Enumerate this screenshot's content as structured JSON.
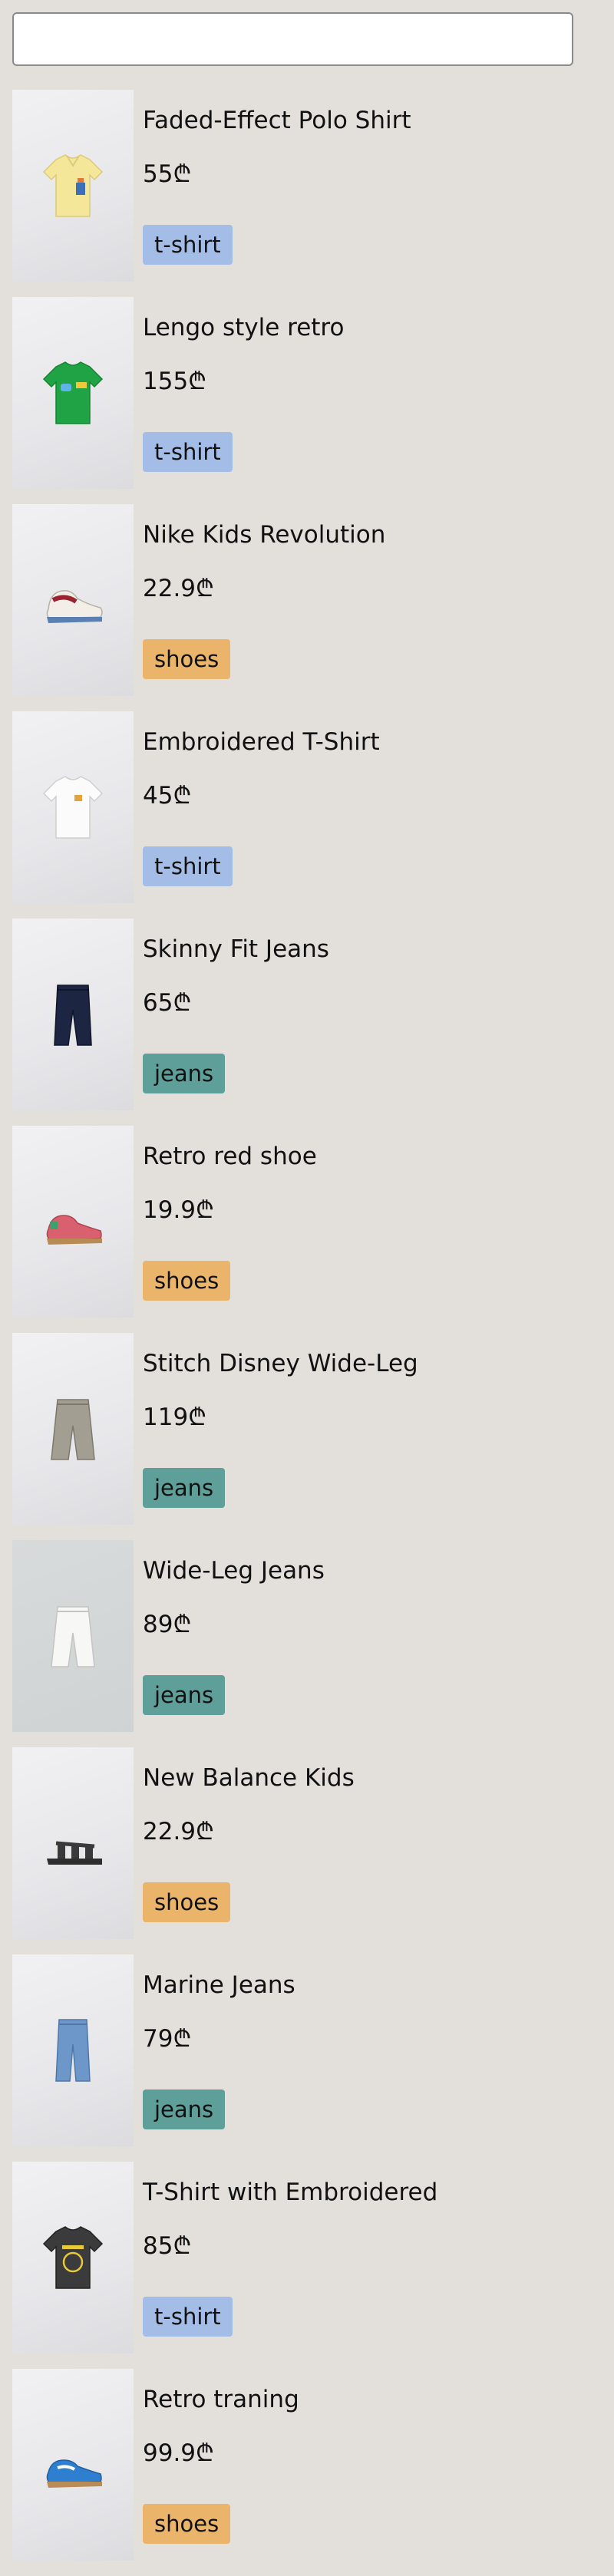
{
  "search": {
    "value": "",
    "placeholder": ""
  },
  "products": [
    {
      "name": "Faded-Effect Polo Shirt",
      "price": "55₾",
      "tag": "t-shirt",
      "icon": "yellow-polo-shirt-image"
    },
    {
      "name": "Lengo style retro",
      "price": "155₾",
      "tag": "t-shirt",
      "icon": "green-tshirt-image"
    },
    {
      "name": "Nike Kids Revolution",
      "price": "22.9₾",
      "tag": "shoes",
      "icon": "sneaker-image"
    },
    {
      "name": "Embroidered T-Shirt",
      "price": "45₾",
      "tag": "t-shirt",
      "icon": "white-tshirt-image"
    },
    {
      "name": "Skinny Fit Jeans",
      "price": "65₾",
      "tag": "jeans",
      "icon": "dark-jeans-image"
    },
    {
      "name": "Retro red shoe",
      "price": "19.9₾",
      "tag": "shoes",
      "icon": "red-shoe-image"
    },
    {
      "name": "Stitch Disney Wide-Leg",
      "price": "119₾",
      "tag": "jeans",
      "icon": "grey-jeans-image"
    },
    {
      "name": "Wide-Leg Jeans",
      "price": "89₾",
      "tag": "jeans",
      "icon": "white-jeans-image"
    },
    {
      "name": "New Balance Kids",
      "price": "22.9₾",
      "tag": "shoes",
      "icon": "sandal-image"
    },
    {
      "name": "Marine Jeans",
      "price": "79₾",
      "tag": "jeans",
      "icon": "blue-jeans-image"
    },
    {
      "name": "T-Shirt with Embroidered",
      "price": "85₾",
      "tag": "t-shirt",
      "icon": "black-tshirt-image"
    },
    {
      "name": "Retro traning",
      "price": "99.9₾",
      "tag": "shoes",
      "icon": "blue-sneaker-image"
    }
  ],
  "colors": {
    "background": "#e3e0dc",
    "tag_tshirt": "#a3bde6",
    "tag_shoes": "#eab56a",
    "tag_jeans": "#5f9f9a"
  }
}
